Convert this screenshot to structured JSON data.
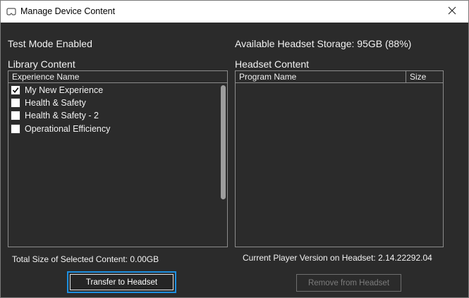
{
  "window": {
    "title": "Manage Device Content",
    "icon": "headset-icon",
    "close_icon": "close-icon"
  },
  "status": {
    "test_mode": "Test Mode Enabled",
    "storage": "Available Headset Storage: 95GB (88%)"
  },
  "library": {
    "heading": "Library Content",
    "column": "Experience Name",
    "items": [
      {
        "label": "My New Experience",
        "checked": true
      },
      {
        "label": "Health & Safety",
        "checked": false
      },
      {
        "label": "Health & Safety - 2",
        "checked": false
      },
      {
        "label": "Operational Efficiency",
        "checked": false
      }
    ],
    "total_size": "Total Size of Selected Content: 0.00GB"
  },
  "headset": {
    "heading": "Headset Content",
    "columns": [
      "Program Name",
      "Size"
    ],
    "player_version": "Current Player Version on Headset: 2.14.22292.04"
  },
  "buttons": {
    "transfer": "Transfer to Headset",
    "remove": "Remove from Headset"
  }
}
